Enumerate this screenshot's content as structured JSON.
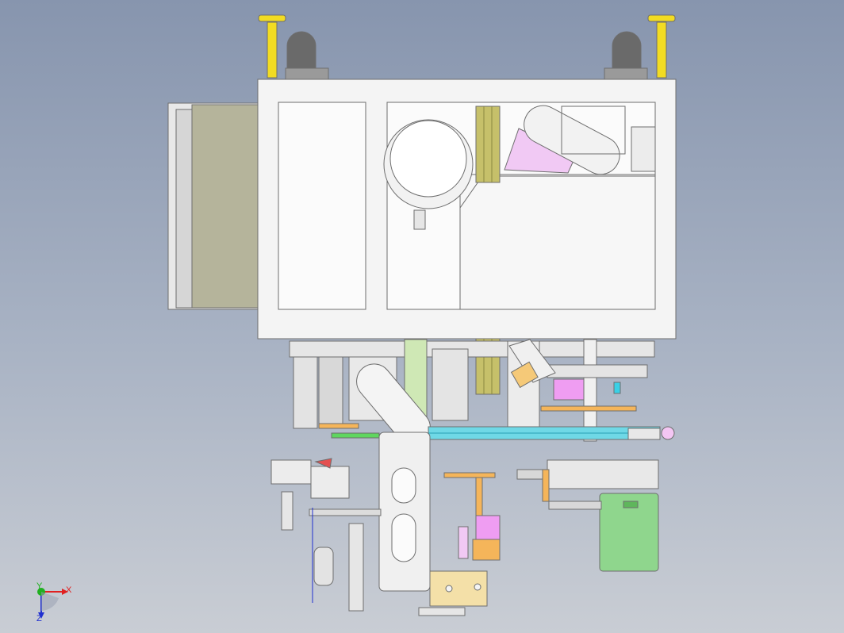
{
  "viewport": {
    "background_top": "#8795ae",
    "background_bottom": "#c9cdd4"
  },
  "model": {
    "colors": {
      "frame": "#f4f4f4",
      "outline": "#6e6e6e",
      "panel": "#b5b49b",
      "yellow": "#f2dc23",
      "roller": "#6a6a6a",
      "green_strip": "#cfe8b5",
      "pink": "#ef9df2",
      "orange": "#f5b55a",
      "cyan": "#39d0e6",
      "motor_green": "#8fd68d"
    }
  },
  "triad": {
    "x_label": "X",
    "y_label": "Y",
    "z_label": "Z",
    "x_color": "#e02020",
    "y_color": "#20b020",
    "z_color": "#2030d0"
  }
}
